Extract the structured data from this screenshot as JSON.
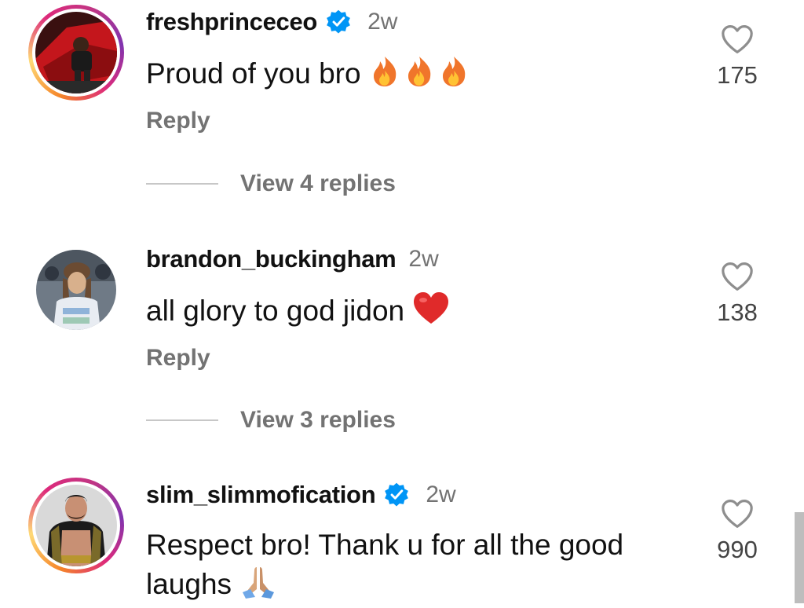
{
  "comments": [
    {
      "username": "freshprinceceo",
      "time": "2w",
      "text": "Proud of you bro",
      "reply_label": "Reply",
      "view_replies": "View 4 replies",
      "likes": "175"
    },
    {
      "username": "brandon_buckingham",
      "time": "2w",
      "text": "all glory to god jidon",
      "reply_label": "Reply",
      "view_replies": "View 3 replies",
      "likes": "138"
    },
    {
      "username": "slim_slimmofication",
      "time": "2w",
      "text_line1": "Respect bro! Thank u for all the good",
      "text_line2": "laughs",
      "likes": "990"
    }
  ],
  "colors": {
    "verified": "#0095f6",
    "muted": "#737373",
    "heart_outline": "#8e8e8e"
  }
}
